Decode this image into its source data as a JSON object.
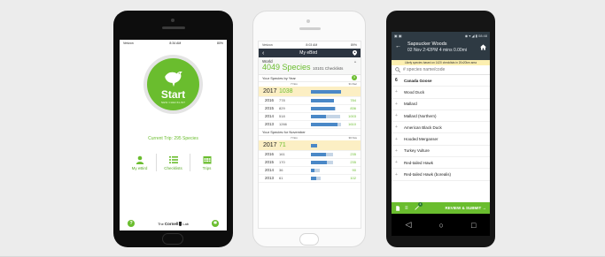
{
  "phone1": {
    "status": {
      "carrier": "Verizon",
      "time": "8:34 AM",
      "battery": "80%"
    },
    "start_label": "Start",
    "start_sub": "NEW CHECKLIST",
    "trip": "Current Trip: 295 Species",
    "nav": [
      {
        "label": "My eBird",
        "icon": "person-icon"
      },
      {
        "label": "Checklists",
        "icon": "list-icon"
      },
      {
        "label": "Trips",
        "icon": "calendar-icon"
      }
    ],
    "help": "?",
    "cornell": {
      "the": "The",
      "name": "Cornell",
      "lab": "Lab"
    },
    "colors": {
      "green": "#6abd2e"
    }
  },
  "phone2": {
    "status": {
      "carrier": "Verizon",
      "time": "8:03 AM",
      "battery": "89%"
    },
    "header_title": "My eBird",
    "world_label": "World",
    "world_species": "4049 Species",
    "world_checklists": "10101 Checklists",
    "by_year_title": "Your Species by Year",
    "by_year_dates": {
      "start": "7 Nov",
      "end": "31 Dec"
    },
    "by_year": [
      {
        "year": "2017",
        "count": "1038",
        "total": "",
        "fill": 1.0,
        "bg": 1.0,
        "highlight": true
      },
      {
        "year": "2016",
        "count": "778",
        "total": "784",
        "fill": 0.75,
        "bg": 0.76,
        "highlight": false
      },
      {
        "year": "2015",
        "count": "829",
        "total": "836",
        "fill": 0.8,
        "bg": 0.81,
        "highlight": false
      },
      {
        "year": "2014",
        "count": "518",
        "total": "1003",
        "fill": 0.5,
        "bg": 0.97,
        "highlight": false
      },
      {
        "year": "2013",
        "count": "1266",
        "total": "1610",
        "fill": 0.88,
        "bg": 1.0,
        "highlight": false
      }
    ],
    "by_month_title": "Your Species for November",
    "by_month_dates": {
      "start": "7 Nov",
      "end": "30 Nov"
    },
    "by_month": [
      {
        "year": "2017",
        "count": "71",
        "total": "",
        "fill": 0.22,
        "bg": 0.22,
        "highlight": true
      },
      {
        "year": "2016",
        "count": "161",
        "total": "235",
        "fill": 0.5,
        "bg": 0.73,
        "highlight": false
      },
      {
        "year": "2015",
        "count": "170",
        "total": "235",
        "fill": 0.53,
        "bg": 0.73,
        "highlight": false
      },
      {
        "year": "2014",
        "count": "36",
        "total": "90",
        "fill": 0.11,
        "bg": 0.28,
        "highlight": false
      },
      {
        "year": "2013",
        "count": "61",
        "total": "102",
        "fill": 0.19,
        "bg": 0.32,
        "highlight": false
      }
    ],
    "help": "?"
  },
  "phone3": {
    "status": {
      "time": "08:48"
    },
    "title": "Sapsucker Woods",
    "subtitle": "02 Nov 2:42PM  4 mins 0.00mi",
    "banner": "Likely species based on 1420 checklists in 20x20km area",
    "search_placeholder": "# species name/code",
    "species": [
      {
        "num": "6",
        "name": "Canada Goose",
        "set": true
      },
      {
        "num": "+",
        "name": "Wood Duck",
        "set": false
      },
      {
        "num": "+",
        "name": "Mallard",
        "set": false
      },
      {
        "num": "+",
        "name": "Mallard (Northern)",
        "set": false
      },
      {
        "num": "+",
        "name": "American Black Duck",
        "set": false
      },
      {
        "num": "+",
        "name": "Hooded Merganser",
        "set": false
      },
      {
        "num": "+",
        "name": "Turkey Vulture",
        "set": false
      },
      {
        "num": "+",
        "name": "Red-tailed Hawk",
        "set": false
      },
      {
        "num": "+",
        "name": "Red-tailed Hawk (borealis)",
        "set": false
      }
    ],
    "badge": "1",
    "submit": "REVIEW & SUBMIT →",
    "nav": {
      "back": "◁",
      "home": "○",
      "recent": "□"
    }
  }
}
